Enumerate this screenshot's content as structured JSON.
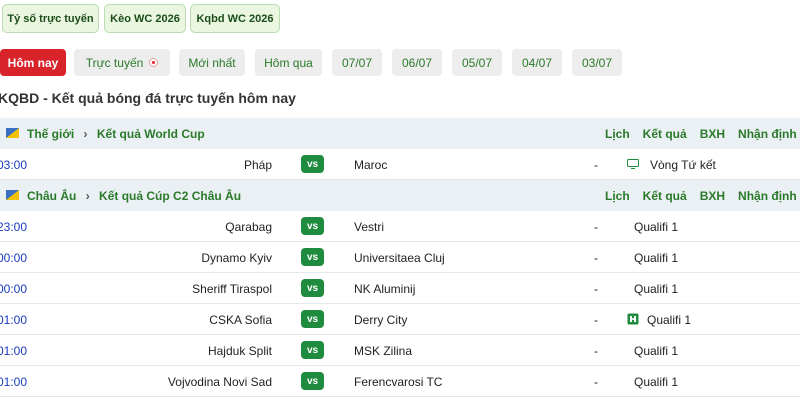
{
  "top_pills": [
    "Tỷ số trực tuyến",
    "Kèo WC 2026",
    "Kqbd WC 2026"
  ],
  "date_tabs": [
    {
      "label": "Hôm nay",
      "active": true
    },
    {
      "label": "Trực tuyến",
      "live": true
    },
    {
      "label": "Mới nhất"
    },
    {
      "label": "Hôm qua"
    },
    {
      "label": "07/07"
    },
    {
      "label": "06/07"
    },
    {
      "label": "05/07"
    },
    {
      "label": "04/07"
    },
    {
      "label": "03/07"
    }
  ],
  "page_title": "KQBD - Kết quả bóng đá trực tuyến hôm nay",
  "league_links": [
    "Lịch",
    "Kết quả",
    "BXH",
    "Nhận định"
  ],
  "vs_label": "vs",
  "leagues": [
    {
      "region": "Thế giới",
      "separator": "›",
      "competition": "Kết quả World Cup",
      "matches": [
        {
          "time": "03:00",
          "home": "Pháp",
          "away": "Maroc",
          "dash": "-",
          "round": "Vòng Tứ kết",
          "icon": "tv-icon"
        }
      ]
    },
    {
      "region": "Châu Âu",
      "separator": "›",
      "competition": "Kết quả Cúp C2 Châu Âu",
      "matches": [
        {
          "time": "23:00",
          "home": "Qarabag",
          "away": "Vestri",
          "dash": "-",
          "round": "Qualifi 1"
        },
        {
          "time": "00:00",
          "home": "Dynamo Kyiv",
          "away": "Universitaea Cluj",
          "dash": "-",
          "round": "Qualifi 1"
        },
        {
          "time": "00:00",
          "home": "Sheriff Tiraspol",
          "away": "NK Aluminij",
          "dash": "-",
          "round": "Qualifi 1"
        },
        {
          "time": "01:00",
          "home": "CSKA Sofia",
          "away": "Derry City",
          "dash": "-",
          "round": "Qualifi 1",
          "icon": "field-icon"
        },
        {
          "time": "01:00",
          "home": "Hajduk Split",
          "away": "MSK Zilina",
          "dash": "-",
          "round": "Qualifi 1"
        },
        {
          "time": "01:00",
          "home": "Vojvodina Novi Sad",
          "away": "Ferencvarosi TC",
          "dash": "-",
          "round": "Qualifi 1"
        }
      ]
    }
  ],
  "colors": {
    "active_tab": "#d8232a",
    "vs_badge": "#1e8b3e",
    "link_green": "#2a7a2a",
    "time_blue": "#1a3bbf",
    "league_bg": "#eaf0f4"
  }
}
